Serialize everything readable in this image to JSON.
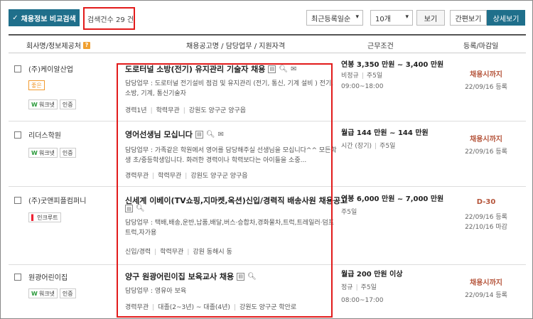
{
  "toolbar": {
    "compare_label": "채용정보 비교검색",
    "count_text": "검색건수 29 건",
    "sort_value": "최근등록일순",
    "size_value": "10개",
    "view_label": "보기",
    "simple_view_label": "간편보기",
    "detail_view_label": "상세보기"
  },
  "header": {
    "company": "회사명/정보제공처",
    "job": "채용공고명 / 담당업무 / 지원자격",
    "cond": "근무조건",
    "date": "등록/마감일"
  },
  "rows": [
    {
      "company": "(주)케이알산업",
      "tag": "좋은",
      "badges": [
        "워크넷",
        "인증"
      ],
      "title": "도로터널 소방(전기) 유지관리 기술자 채용",
      "desc": "담당업무 : 도로터널 전기설비 점검 및 유지관리 (전기, 통신, 기계 설비 ) 전기,소방, 기계, 통신기술자",
      "meta": [
        "경력1년",
        "학력무관",
        "강원도 양구군 양구읍"
      ],
      "salary": "연봉 3,350 만원 ~ 3,400 만원",
      "cond1": "비정규",
      "cond2": "주5일",
      "hours": "09:00~18:00",
      "deadline": "채용시까지",
      "dates": [
        "22/09/16 등록"
      ]
    },
    {
      "company": "리더스학원",
      "badges": [
        "워크넷",
        "인증"
      ],
      "title": "영어선생님 모십니다",
      "desc": "담당업무 : 가족같은 학원에서 영어를 담당해주실 선생님을 모십니다^^ 모든학생 초/중등학생입니다. 화려한 경력이나 학력보다는 아이들을 소중...",
      "meta": [
        "경력무관",
        "학력무관",
        "강원도 양구군 양구읍"
      ],
      "salary": "월급 144 만원 ~ 144 만원",
      "cond1": "시간 (장기)",
      "cond2": "주5일",
      "deadline": "채용시까지",
      "dates": [
        "22/09/16 등록"
      ]
    },
    {
      "company": "(주)굿앤피플컴퍼니",
      "badges": [
        "인크루트"
      ],
      "title": "신세계 이베이(TV쇼핑,지마켓,옥션)신입/경력직 배송사원 채용공고",
      "desc": "담당업무 : 택배,배송,운반,납품,배달,버스·승합차,경화물차,트럭,트레일러·덤프트럭,자가용",
      "meta": [
        "신입/경력",
        "학력무관",
        "강원 동해시 동"
      ],
      "salary": "연봉 6,000 만원 ~ 7,000 만원",
      "cond1": "주5일",
      "deadline": "D-30",
      "dates": [
        "22/09/16 등록",
        "22/10/16 마감"
      ]
    },
    {
      "company": "원광어린이집",
      "badges": [
        "워크넷",
        "인증"
      ],
      "title": "양구 원광어린이집 보육교사 채용",
      "desc": "담당업무 : 영유아 보육",
      "meta": [
        "경력무관",
        "대졸(2~3년) ~ 대졸(4년)",
        "강원도 양구군 학안로"
      ],
      "salary": "월급 200 만원 이상",
      "cond1": "정규",
      "cond2": "주5일",
      "hours": "08:00~17:00",
      "deadline": "채용시까지",
      "dates": [
        "22/09/14 등록"
      ]
    }
  ]
}
